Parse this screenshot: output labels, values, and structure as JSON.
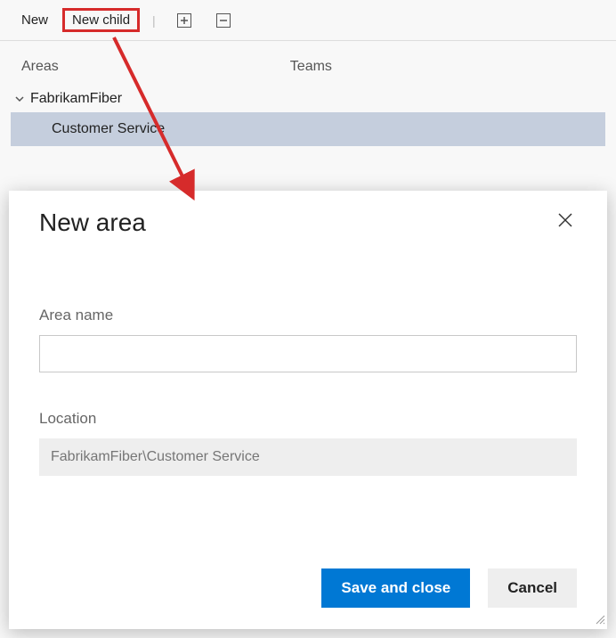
{
  "toolbar": {
    "new_label": "New",
    "new_child_label": "New child"
  },
  "tabs": {
    "areas": "Areas",
    "teams": "Teams"
  },
  "tree": {
    "root": "FabrikamFiber",
    "child": "Customer Service"
  },
  "dialog": {
    "title": "New area",
    "area_name_label": "Area name",
    "area_name_value": "",
    "location_label": "Location",
    "location_value": "FabrikamFiber\\Customer Service",
    "save_label": "Save and close",
    "cancel_label": "Cancel"
  },
  "annotation": {
    "highlight_color": "#d62b2b",
    "arrow_color": "#d62b2b"
  }
}
